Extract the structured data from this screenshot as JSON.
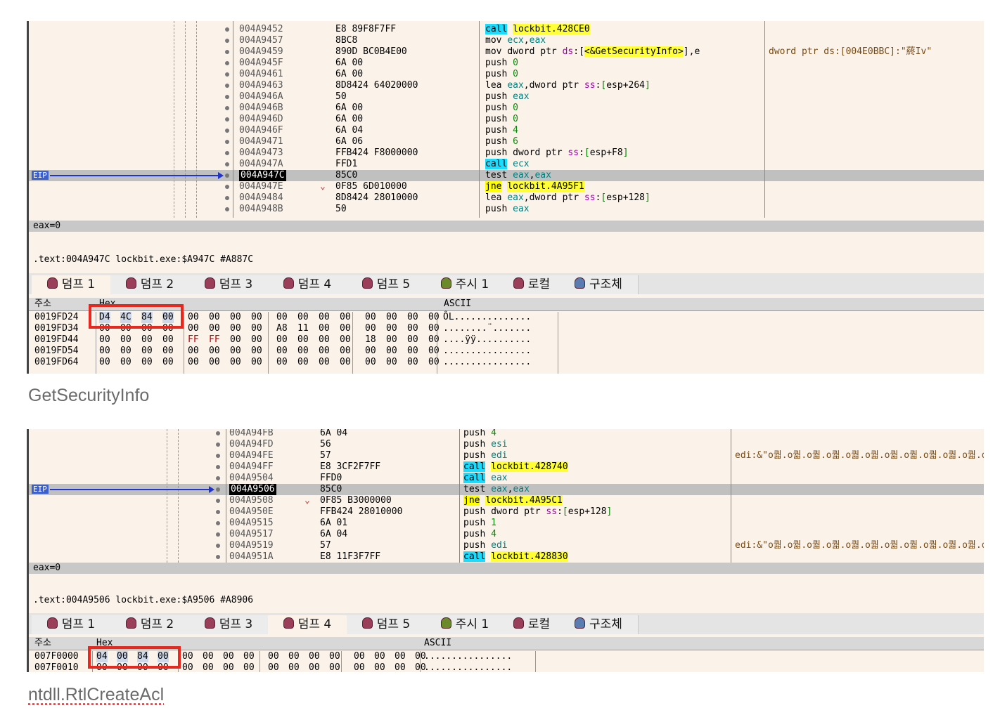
{
  "panel1": {
    "disasm": [
      {
        "addr": "004A9452",
        "bytes": "E8 89F8F7FF",
        "mn": "call",
        "ops": "lockbit.428CE0",
        "kind": "call"
      },
      {
        "addr": "004A9457",
        "bytes": "8BC8",
        "mn": "mov",
        "ops": "ecx,eax",
        "kind": "mov"
      },
      {
        "addr": "004A9459",
        "bytes": "890D BC0B4E00",
        "mn": "mov",
        "ops": "dword ptr ds:[<&GetSecurityInfo>],e",
        "kind": "mov",
        "comment": "dword ptr ds:[004E0BBC]:\"蔠Iv\""
      },
      {
        "addr": "004A945F",
        "bytes": "6A 00",
        "mn": "push",
        "ops": "0",
        "kind": "push"
      },
      {
        "addr": "004A9461",
        "bytes": "6A 00",
        "mn": "push",
        "ops": "0",
        "kind": "push"
      },
      {
        "addr": "004A9463",
        "bytes": "8D8424 64020000",
        "mn": "lea",
        "ops": "eax,dword ptr ss:[esp+264]",
        "kind": "lea"
      },
      {
        "addr": "004A946A",
        "bytes": "50",
        "mn": "push",
        "ops": "eax",
        "kind": "push"
      },
      {
        "addr": "004A946B",
        "bytes": "6A 00",
        "mn": "push",
        "ops": "0",
        "kind": "push"
      },
      {
        "addr": "004A946D",
        "bytes": "6A 00",
        "mn": "push",
        "ops": "0",
        "kind": "push"
      },
      {
        "addr": "004A946F",
        "bytes": "6A 04",
        "mn": "push",
        "ops": "4",
        "kind": "push"
      },
      {
        "addr": "004A9471",
        "bytes": "6A 06",
        "mn": "push",
        "ops": "6",
        "kind": "push"
      },
      {
        "addr": "004A9473",
        "bytes": "FFB424 F8000000",
        "mn": "push",
        "ops": "dword ptr ss:[esp+F8]",
        "kind": "push"
      },
      {
        "addr": "004A947A",
        "bytes": "FFD1",
        "mn": "call",
        "ops": "ecx",
        "kind": "call"
      },
      {
        "addr": "004A947C",
        "bytes": "85C0",
        "mn": "test",
        "ops": "eax,eax",
        "kind": "test"
      },
      {
        "addr": "004A947E",
        "bytes": "0F85 6D010000",
        "mn": "jne",
        "ops": "lockbit.4A95F1",
        "kind": "jne"
      },
      {
        "addr": "004A9484",
        "bytes": "8D8424 28010000",
        "mn": "lea",
        "ops": "eax,dword ptr ss:[esp+128]",
        "kind": "lea"
      },
      {
        "addr": "004A948B",
        "bytes": "50",
        "mn": "push",
        "ops": "eax",
        "kind": "push"
      }
    ],
    "eip_label": "EIP",
    "status": "eax=0",
    "location": ".text:004A947C lockbit.exe:$A947C #A887C",
    "tabs": [
      "덤프 1",
      "덤프 2",
      "덤프 3",
      "덤프 4",
      "덤프 5",
      "주시 1",
      "로컬",
      "구조체"
    ],
    "active_tab": 0,
    "dump_headers": {
      "addr": "주소",
      "hex": "Hex",
      "ascii": "ASCII"
    },
    "dump_rows": [
      {
        "addr": "0019FD24",
        "hex": [
          "D4",
          "4C",
          "84",
          "00",
          "00",
          "00",
          "00",
          "00",
          "00",
          "00",
          "00",
          "00",
          "00",
          "00",
          "00",
          "00"
        ],
        "ascii": "ÔL.............."
      },
      {
        "addr": "0019FD34",
        "hex": [
          "00",
          "00",
          "00",
          "00",
          "00",
          "00",
          "00",
          "00",
          "A8",
          "11",
          "00",
          "00",
          "00",
          "00",
          "00",
          "00"
        ],
        "ascii": "........¨......."
      },
      {
        "addr": "0019FD44",
        "hex": [
          "00",
          "00",
          "00",
          "00",
          "FF",
          "FF",
          "00",
          "00",
          "00",
          "00",
          "00",
          "00",
          "18",
          "00",
          "00",
          "00"
        ],
        "ascii": "....ÿÿ.........."
      },
      {
        "addr": "0019FD54",
        "hex": [
          "00",
          "00",
          "00",
          "00",
          "00",
          "00",
          "00",
          "00",
          "00",
          "00",
          "00",
          "00",
          "00",
          "00",
          "00",
          "00"
        ],
        "ascii": "................"
      },
      {
        "addr": "0019FD64",
        "hex": [
          "00",
          "00",
          "00",
          "00",
          "00",
          "00",
          "00",
          "00",
          "00",
          "00",
          "00",
          "00",
          "00",
          "00",
          "00",
          "00"
        ],
        "ascii": "................"
      }
    ]
  },
  "caption1": "GetSecurityInfo",
  "panel2": {
    "disasm": [
      {
        "addr": "004A94FB",
        "bytes": "6A 04",
        "mn": "push",
        "ops": "4",
        "kind": "push"
      },
      {
        "addr": "004A94FD",
        "bytes": "56",
        "mn": "push",
        "ops": "esi",
        "kind": "push"
      },
      {
        "addr": "004A94FE",
        "bytes": "57",
        "mn": "push",
        "ops": "edi",
        "kind": "push",
        "comment": "edi:&\"o퀇.o퀇.o퀇.o퀇.o퀇.o퀇.o퀇.o퀇.o퀇.o퀇.o퀇.o"
      },
      {
        "addr": "004A94FF",
        "bytes": "E8 3CF2F7FF",
        "mn": "call",
        "ops": "lockbit.428740",
        "kind": "call"
      },
      {
        "addr": "004A9504",
        "bytes": "FFD0",
        "mn": "call",
        "ops": "eax",
        "kind": "call"
      },
      {
        "addr": "004A9506",
        "bytes": "85C0",
        "mn": "test",
        "ops": "eax,eax",
        "kind": "test"
      },
      {
        "addr": "004A9508",
        "bytes": "0F85 B3000000",
        "mn": "jne",
        "ops": "lockbit.4A95C1",
        "kind": "jne"
      },
      {
        "addr": "004A950E",
        "bytes": "FFB424 28010000",
        "mn": "push",
        "ops": "dword ptr ss:[esp+128]",
        "kind": "push"
      },
      {
        "addr": "004A9515",
        "bytes": "6A 01",
        "mn": "push",
        "ops": "1",
        "kind": "push"
      },
      {
        "addr": "004A9517",
        "bytes": "6A 04",
        "mn": "push",
        "ops": "4",
        "kind": "push"
      },
      {
        "addr": "004A9519",
        "bytes": "57",
        "mn": "push",
        "ops": "edi",
        "kind": "push",
        "comment": "edi:&\"o퀇.o퀇.o퀇.o퀇.o퀇.o퀇.o퀇.o퀇.o퀇.o퀇.o퀇.o"
      },
      {
        "addr": "004A951A",
        "bytes": "E8 11F3F7FF",
        "mn": "call",
        "ops": "lockbit.428830",
        "kind": "call"
      }
    ],
    "eip_label": "EIP",
    "status": "eax=0",
    "location": ".text:004A9506 lockbit.exe:$A9506 #A8906",
    "tabs": [
      "덤프 1",
      "덤프 2",
      "덤프 3",
      "덤프 4",
      "덤프 5",
      "주시 1",
      "로컬",
      "구조체"
    ],
    "active_tab": 3,
    "dump_headers": {
      "addr": "주소",
      "hex": "Hex",
      "ascii": "ASCII"
    },
    "dump_rows": [
      {
        "addr": "007F0000",
        "hex": [
          "04",
          "00",
          "84",
          "00",
          "00",
          "00",
          "00",
          "00",
          "00",
          "00",
          "00",
          "00",
          "00",
          "00",
          "00",
          "00"
        ],
        "ascii": "................"
      },
      {
        "addr": "007F0010",
        "hex": [
          "00",
          "00",
          "00",
          "00",
          "00",
          "00",
          "00",
          "00",
          "00",
          "00",
          "00",
          "00",
          "00",
          "00",
          "00",
          "00"
        ],
        "ascii": "................"
      }
    ]
  },
  "caption2": "ntdll.RtlCreateAcl"
}
